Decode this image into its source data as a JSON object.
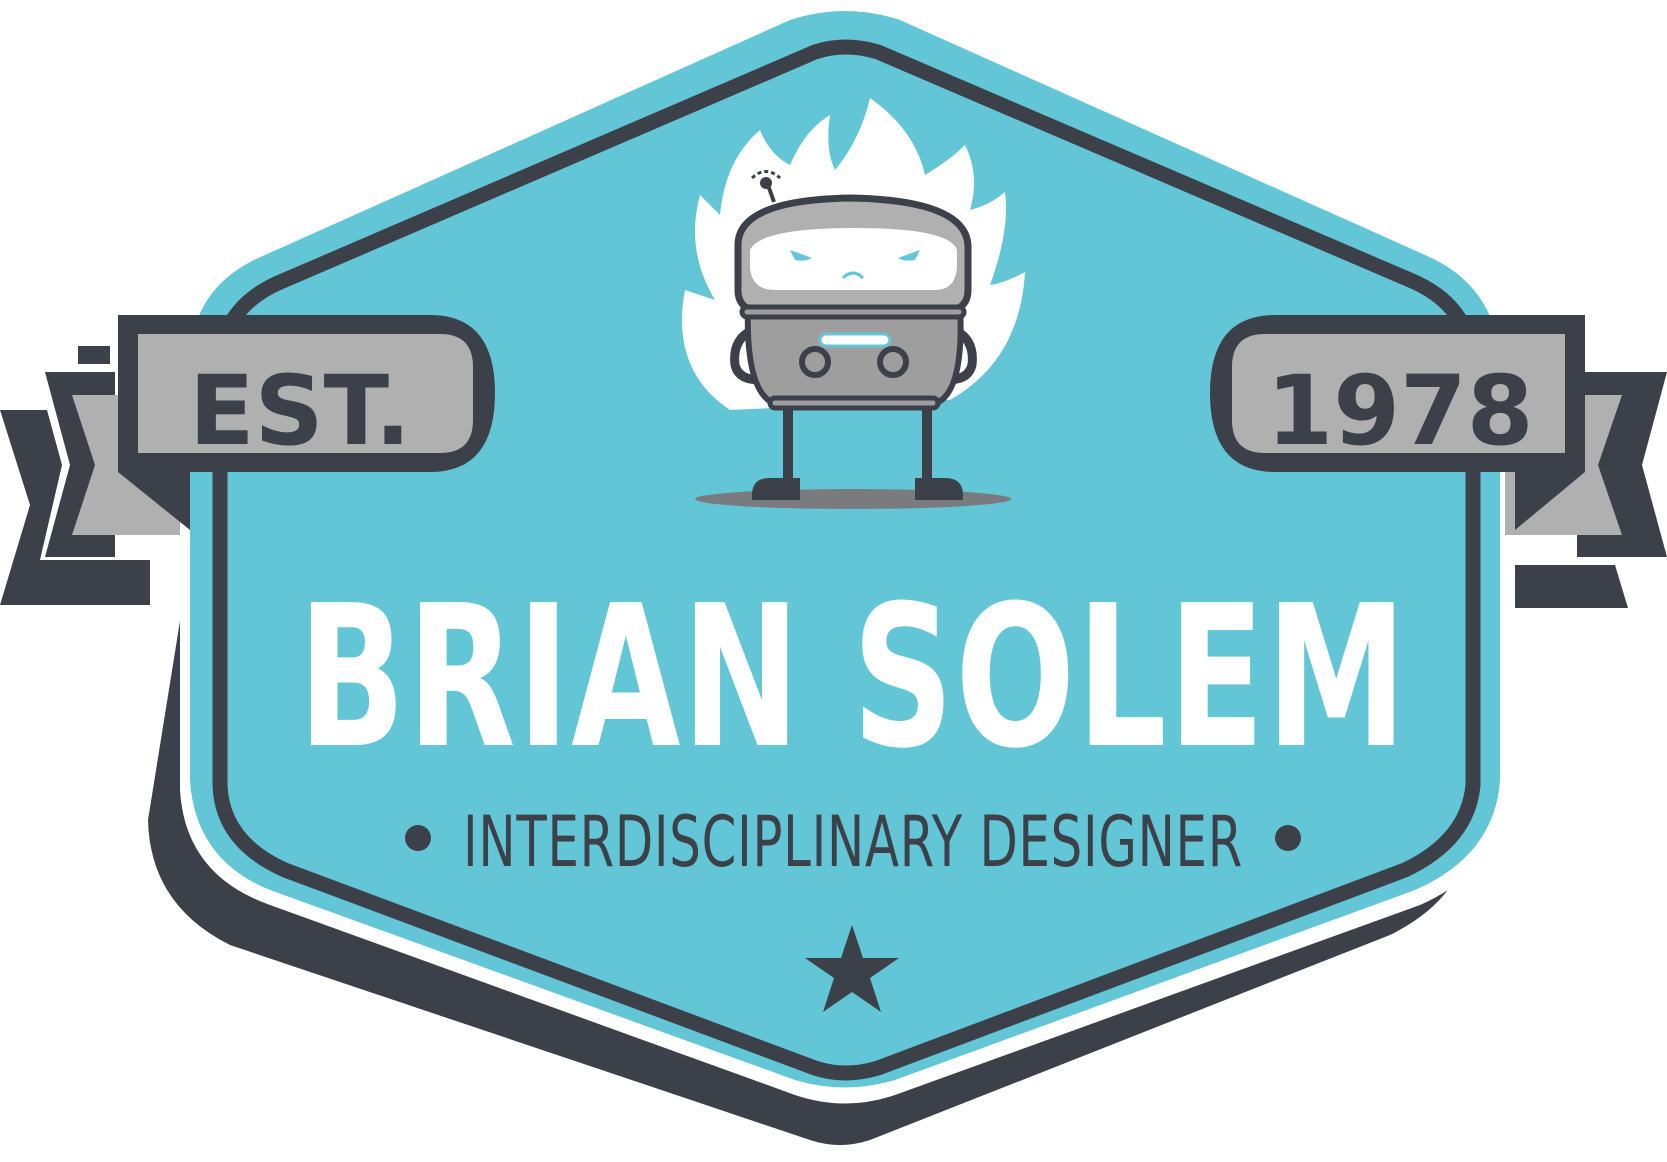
{
  "badge": {
    "name": "BRIAN SOLEM",
    "tagline": "INTERDISCIPLINARY DESIGNER",
    "ribbon_left": "EST.",
    "ribbon_right": "1978"
  },
  "colors": {
    "badge_fill": "#63c6d6",
    "outline": "#3b4049",
    "ribbon_fill": "#b0b0b0",
    "robot_body": "#9e9e9f",
    "robot_face": "#ffffff",
    "accent": "#63c6d6"
  },
  "icons": {
    "mascot": "robot-mascot-icon",
    "star": "star-icon",
    "bullet": "dot-icon"
  }
}
